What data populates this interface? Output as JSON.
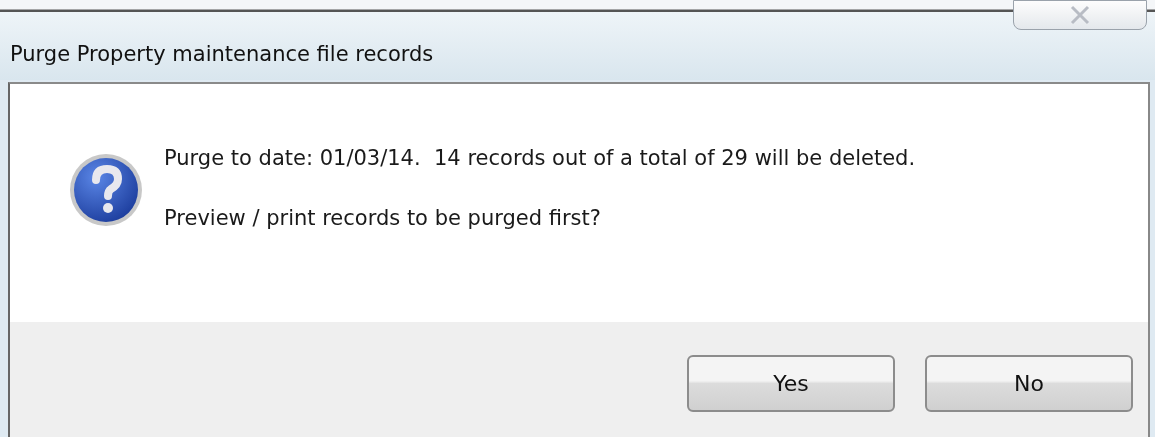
{
  "window": {
    "title": "Purge Property maintenance file records"
  },
  "message": {
    "lines": [
      "Purge to date: 01/03/14.  14 records out of a total of 29 will be deleted.",
      "Preview / print records to be purged first?"
    ]
  },
  "buttons": [
    {
      "label": "Yes"
    },
    {
      "label": "No"
    }
  ]
}
